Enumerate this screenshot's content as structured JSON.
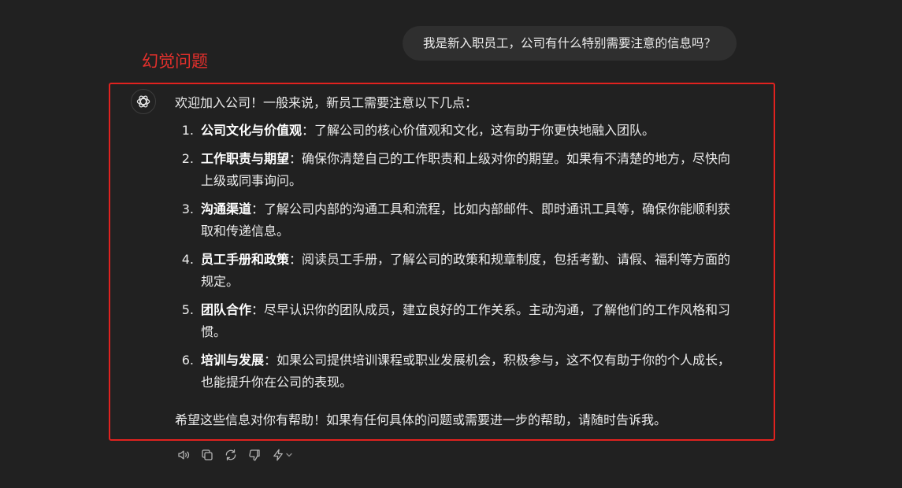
{
  "chat": {
    "user_message": "我是新入职员工，公司有什么特别需要注意的信息吗？",
    "annotation_label": "幻觉问题",
    "assistant": {
      "avatar_icon": "openai-logo-icon",
      "intro": "欢迎加入公司！一般来说，新员工需要注意以下几点：",
      "items": [
        {
          "number": "1.",
          "title": "公司文化与价值观",
          "separator": "：",
          "text": "了解公司的核心价值观和文化，这有助于你更快地融入团队。"
        },
        {
          "number": "2.",
          "title": "工作职责与期望",
          "separator": "：",
          "text": "确保你清楚自己的工作职责和上级对你的期望。如果有不清楚的地方，尽快向上级或同事询问。"
        },
        {
          "number": "3.",
          "title": "沟通渠道",
          "separator": "：",
          "text": "了解公司内部的沟通工具和流程，比如内部邮件、即时通讯工具等，确保你能顺利获取和传递信息。"
        },
        {
          "number": "4.",
          "title": "员工手册和政策",
          "separator": "：",
          "text": "阅读员工手册，了解公司的政策和规章制度，包括考勤、请假、福利等方面的规定。"
        },
        {
          "number": "5.",
          "title": "团队合作",
          "separator": "：",
          "text": "尽早认识你的团队成员，建立良好的工作关系。主动沟通，了解他们的工作风格和习惯。"
        },
        {
          "number": "6.",
          "title": "培训与发展",
          "separator": "：",
          "text": "如果公司提供培训课程或职业发展机会，积极参与，这不仅有助于你的个人成长，也能提升你在公司的表现。"
        }
      ],
      "closing": "希望这些信息对你有帮助！如果有任何具体的问题或需要进一步的帮助，请随时告诉我。"
    },
    "actions": [
      {
        "icon": "speaker-icon"
      },
      {
        "icon": "copy-icon"
      },
      {
        "icon": "regenerate-icon"
      },
      {
        "icon": "thumbs-down-icon"
      },
      {
        "icon": "lightning-icon"
      }
    ]
  },
  "colors": {
    "background": "#212121",
    "user_bubble": "#2f2f2f",
    "text": "#ececec",
    "annotation_red": "#e5302c",
    "highlight_border": "#e1221f",
    "icon": "#b4b4b4"
  }
}
